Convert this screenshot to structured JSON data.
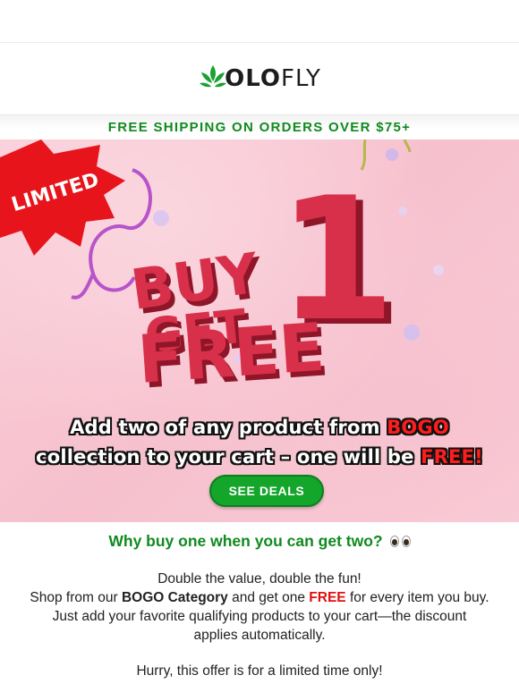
{
  "brand": {
    "logo_text_bold": "OLO",
    "logo_text_light": "FLY",
    "logo_icon": "leaf-icon"
  },
  "shipping_banner": {
    "text": "FREE SHIPPING ON ORDERS OVER $75+"
  },
  "hero": {
    "badge_text": "LIMITED",
    "promo_line1": "BUY",
    "promo_number": "1",
    "promo_line2": "GET",
    "promo_line3": "FREE",
    "line1_pre": "Add two of any product from ",
    "line1_highlight": "BOGO",
    "line2_pre": "collection to your cart – one will be ",
    "line2_highlight": "FREE!",
    "cta_label": "SEE DEALS",
    "colors": {
      "accent_green": "#14a52b",
      "promo_red": "#d8304a",
      "badge_red": "#e8141c"
    }
  },
  "content": {
    "headline": "Why buy one when you can get two?",
    "headline_icon": "eyes-icon",
    "p1": "Double the value, double the fun!",
    "p2_pre": "Shop from our ",
    "p2_bold": "BOGO Category",
    "p2_mid": " and get one ",
    "p2_free": "FREE",
    "p2_post": " for every item you buy.",
    "p3": "Just add your favorite qualifying products to your cart—the discount applies automatically.",
    "hurry": "Hurry, this offer is for a limited time only!"
  }
}
